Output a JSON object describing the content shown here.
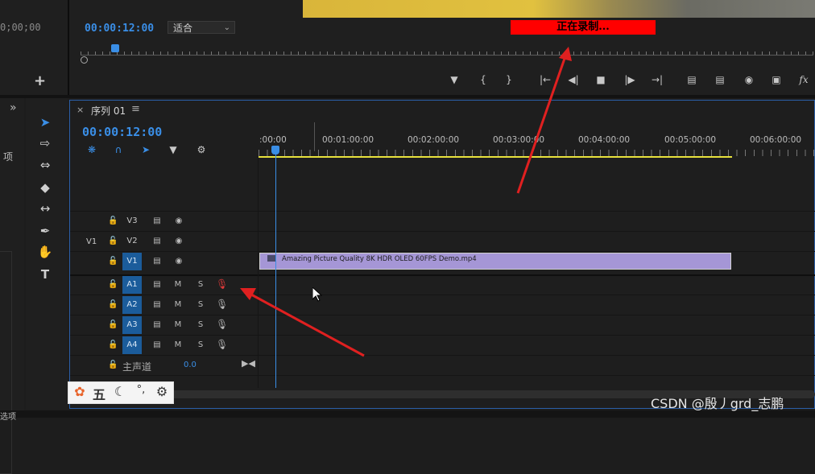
{
  "top": {
    "left_timecode": "0;00;00",
    "program_timecode": "00:00:12:00",
    "fit_select": "适合",
    "recording_text": "正在录制..."
  },
  "sequence": {
    "title": "序列 01",
    "timecode": "00:00:12:00",
    "ruler_labels": [
      ":00:00",
      "00:01:00:00",
      "00:02:00:00",
      "00:03:00:00",
      "00:04:00:00",
      "00:05:00:00",
      "00:06:00:00"
    ],
    "tracks": {
      "video": [
        {
          "name": "V3",
          "target": "",
          "on": false
        },
        {
          "name": "V2",
          "target": "V1",
          "on": false
        },
        {
          "name": "V1",
          "target": "",
          "on": true
        }
      ],
      "audio": [
        {
          "name": "A1",
          "on": true,
          "m": "M",
          "s": "S"
        },
        {
          "name": "A2",
          "on": true,
          "m": "M",
          "s": "S"
        },
        {
          "name": "A3",
          "on": true,
          "m": "M",
          "s": "S"
        },
        {
          "name": "A4",
          "on": true,
          "m": "M",
          "s": "S"
        }
      ]
    },
    "clip_name": "Amazing Picture Quality 8K HDR OLED 60FPS Demo.mp4",
    "master_label": "主声道",
    "master_value": "0.0"
  },
  "left": {
    "item_label": "项",
    "bottom_label": "选项"
  },
  "ime": {
    "wu": "五"
  },
  "watermark": "CSDN @殷丿grd_志鹏",
  "colors": {
    "accent": "#3a8ee6",
    "recording": "#ff0000",
    "clip": "#a596d6",
    "work_area": "#e8e23c",
    "arrow": "#e02020"
  }
}
